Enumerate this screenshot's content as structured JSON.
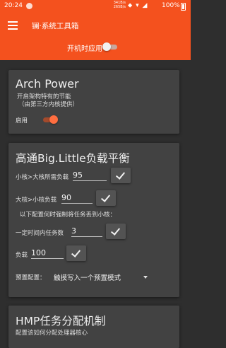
{
  "status": {
    "time": "20:24",
    "net_up": "341B/s",
    "net_down": "265B/s",
    "icons": "⬥ ▾ ◢",
    "battery": "100%"
  },
  "appbar": {
    "title": "镧·系统工具箱",
    "boot_apply_label": "开机时应用",
    "boot_apply_on": false
  },
  "arch_power": {
    "title": "Arch Power",
    "desc_line1": "开启架构特有的节能",
    "desc_line2": "（由第三方内核提供）",
    "enable_label": "启用",
    "enabled": true
  },
  "hmp_balance": {
    "title": "高通Big.Little负载平衡",
    "up_label": "小核>大核所需负载",
    "up_value": "95",
    "down_label": "大核>小核负载",
    "down_value": "90",
    "note": "以下配置何时强制将任务丢到小核：",
    "count_label": "一定时间内任务数",
    "count_value": "3",
    "load_label": "负载",
    "load_value": "100",
    "preset_label": "预置配置：",
    "preset_value": "触摸写入一个预置模式"
  },
  "hmp_sched": {
    "title": "HMP任务分配机制",
    "desc": "配置该如何分配处理器核心"
  }
}
